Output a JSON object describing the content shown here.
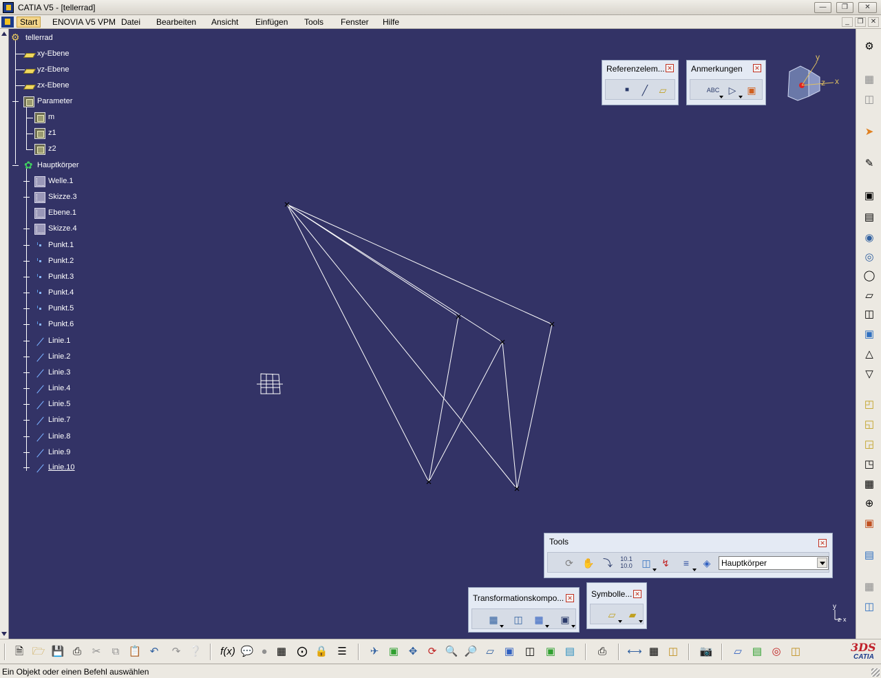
{
  "window": {
    "title": "CATIA V5 - [tellerrad]",
    "controls": [
      "minimize",
      "maximize",
      "close"
    ]
  },
  "menu": {
    "items": [
      "Start",
      "ENOVIA V5 VPM",
      "Datei",
      "Bearbeiten",
      "Ansicht",
      "Einfügen",
      "Tools",
      "Fenster",
      "Hilfe"
    ],
    "active": "Start"
  },
  "tree": {
    "root": "tellerrad",
    "planes": [
      "xy-Ebene",
      "yz-Ebene",
      "zx-Ebene"
    ],
    "parameter_label": "Parameter",
    "parameters": [
      "m",
      "z1",
      "z2"
    ],
    "body_label": "Hauptkörper",
    "features": [
      "Welle.1",
      "Skizze.3",
      "Ebene.1",
      "Skizze.4"
    ],
    "points": [
      "Punkt.1",
      "Punkt.2",
      "Punkt.3",
      "Punkt.4",
      "Punkt.5",
      "Punkt.6"
    ],
    "lines": [
      "Linie.1",
      "Linie.2",
      "Linie.3",
      "Linie.4",
      "Linie.5",
      "Linie.7",
      "Linie.8",
      "Linie.9",
      "Linie.10"
    ]
  },
  "toolbars": {
    "referenz": {
      "title": "Referenzelem...",
      "buttons": [
        "point-icon",
        "line-icon",
        "plane-icon"
      ]
    },
    "anmerkungen": {
      "title": "Anmerkungen",
      "buttons": [
        "text-with-leader-icon",
        "flag-note-icon",
        "annotation-3d-icon"
      ]
    },
    "tools": {
      "title": "Tools",
      "buttons": [
        "update-icon",
        "hand-icon",
        "axis-system-icon",
        "units-icon",
        "catalog-icon",
        "snap-icon",
        "list-icon",
        "eraser-icon"
      ],
      "current_body": "Hauptkörper"
    },
    "transformation": {
      "title": "Transformationskompo...",
      "buttons": [
        "translate-icon",
        "symmetry-icon",
        "pattern-icon",
        "scale-icon"
      ]
    },
    "symbolle": {
      "title": "Symbolle...",
      "buttons": [
        "measure-between-icon",
        "measure-item-icon"
      ]
    }
  },
  "compass": {
    "axes": [
      "y",
      "z",
      "x"
    ]
  },
  "axis_indicator": {
    "labels": [
      "y",
      "z",
      "x"
    ]
  },
  "status": {
    "message": "Ein Objekt oder einen Befehl auswählen"
  },
  "branding": {
    "ds": "3DS",
    "product": "CATIA"
  },
  "colors": {
    "viewport_bg": "#333366",
    "tree_text": "#ffffff",
    "geometry": "#ffffff",
    "active_menu": "#f3d58a"
  },
  "right_toolbar_icons": [
    "options-icon",
    "select-icon",
    "sketcher-icon",
    "pad-icon",
    "pocket-icon",
    "shaft-icon",
    "groove-icon",
    "hole-icon",
    "rib-icon",
    "slot-icon",
    "stiffener-icon",
    "loft-icon",
    "remove-loft-icon",
    "fillet-icon",
    "chamfer-icon",
    "draft-icon",
    "shell-icon",
    "thread-icon",
    "split-icon",
    "thickness-icon",
    "surface-icon",
    "boolean-icon",
    "add-icon",
    "transform-icon"
  ],
  "bottom_toolbar_icons": [
    "new-icon",
    "open-icon",
    "save-icon",
    "print-icon",
    "cut-icon",
    "copy-icon",
    "paste-icon",
    "undo-icon",
    "redo-icon",
    "whats-this-icon",
    "formula-icon",
    "comment-icon",
    "light-icon",
    "table-icon",
    "graph-icon",
    "lock-icon",
    "properties-icon",
    "fly-icon",
    "fit-all-icon",
    "pan-icon",
    "rotate-icon",
    "zoom-in-icon",
    "zoom-out-icon",
    "normal-view-icon",
    "iso-view-icon",
    "shading-icon",
    "hide-show-icon",
    "swap-space-icon",
    "quick-view-icon",
    "measure-icon",
    "analysis-icon",
    "bottle-icon",
    "capture-icon",
    "workbench-1-icon",
    "workbench-2-icon",
    "workbench-3-icon",
    "workbench-4-icon"
  ]
}
